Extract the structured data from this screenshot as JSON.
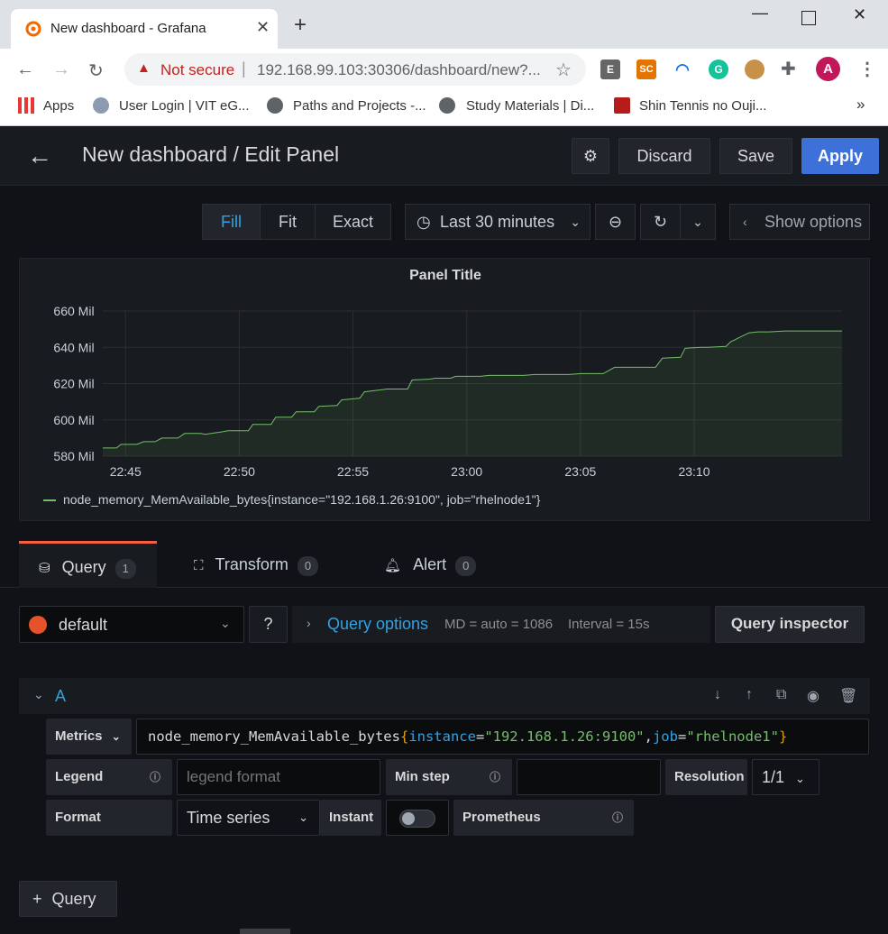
{
  "browser": {
    "tab_title": "New dashboard - Grafana",
    "new_tab": "+",
    "security_label": "Not secure",
    "url": "192.168.99.103:30306/dashboard/new?...",
    "bookmarks": [
      "Apps",
      "User Login | VIT eG...",
      "Paths and Projects -...",
      "Study Materials | Di...",
      "Shin Tennis no Ouji..."
    ],
    "bookmarks_more": "»",
    "profile_initial": "A",
    "ext_e": "E",
    "ext_sc": "SC",
    "ext_g": "G"
  },
  "header": {
    "title": "New dashboard / Edit Panel",
    "discard": "Discard",
    "save": "Save",
    "apply": "Apply"
  },
  "viz": {
    "fill": "Fill",
    "fit": "Fit",
    "exact": "Exact",
    "time_range": "Last 30 minutes",
    "show_options": "Show options"
  },
  "panel": {
    "title": "Panel Title",
    "legend": "node_memory_MemAvailable_bytes{instance=\"192.168.1.26:9100\", job=\"rhelnode1\"}"
  },
  "chart_data": {
    "type": "area",
    "title": "Panel Title",
    "y_ticks": [
      "660 Mil",
      "640 Mil",
      "620 Mil",
      "600 Mil",
      "580 Mil"
    ],
    "ylim": [
      580,
      660
    ],
    "x_ticks": [
      "22:45",
      "22:50",
      "22:55",
      "23:00",
      "23:05",
      "23:10"
    ],
    "series": [
      {
        "name": "node_memory_MemAvailable_bytes{instance=\"192.168.1.26:9100\", job=\"rhelnode1\"}",
        "color": "#73bf69",
        "x_minutes_from_2244": [
          0,
          0.6,
          0.8,
          1.5,
          1.8,
          2.3,
          2.6,
          3.3,
          3.6,
          4.3,
          4.5,
          5.3,
          5.5,
          6.4,
          6.6,
          7.4,
          7.6,
          8.3,
          8.5,
          9.3,
          9.5,
          10.3,
          10.5,
          11.3,
          11.5,
          12.2,
          12.5,
          13.4,
          13.6,
          14.4,
          14.6,
          15.3,
          15.5,
          16.6,
          17.0,
          17.5,
          18.5,
          19.0,
          20.5,
          21.0,
          22.0,
          22.5,
          23.0,
          24.3,
          24.6,
          25.4,
          25.6,
          26.3,
          26.6,
          27.4,
          27.6,
          28.4,
          28.8,
          29.3,
          30.0,
          31.3,
          32.5
        ],
        "values_mil": [
          584.5,
          584.5,
          586.5,
          586.5,
          588.0,
          588.0,
          590.0,
          590.0,
          592.5,
          592.5,
          592.0,
          593.5,
          594.0,
          594.0,
          597.5,
          597.5,
          601.5,
          601.5,
          604.5,
          604.5,
          607.5,
          608.0,
          611.0,
          612.0,
          615.5,
          616.5,
          617.0,
          617.0,
          622.0,
          622.5,
          623.0,
          623.0,
          624.0,
          624.0,
          624.5,
          624.5,
          624.5,
          625.0,
          625.0,
          625.5,
          625.5,
          629.0,
          629.0,
          629.0,
          634.0,
          634.5,
          639.5,
          640.0,
          640.0,
          640.5,
          643.0,
          648.0,
          648.5,
          648.5,
          649.0,
          649.0,
          649.0
        ]
      }
    ]
  },
  "tabs": {
    "query": "Query",
    "query_count": "1",
    "transform": "Transform",
    "transform_count": "0",
    "alert": "Alert",
    "alert_count": "0"
  },
  "query": {
    "datasource": "default",
    "options_label": "Query options",
    "md": "MD = auto = 1086",
    "interval": "Interval = 15s",
    "inspector": "Query inspector",
    "ref_id": "A",
    "metrics_label": "Metrics",
    "metric_name": "node_memory_MemAvailable_bytes",
    "metric_open": "{",
    "metric_k1": "instance",
    "metric_eq1": "=",
    "metric_v1": "\"192.168.1.26:9100\"",
    "metric_comma": ",",
    "metric_k2": "job",
    "metric_eq2": "=",
    "metric_v2": "\"rhelnode1\"",
    "metric_close": "}",
    "legend_label": "Legend",
    "legend_placeholder": "legend format",
    "min_step_label": "Min step",
    "resolution_label": "Resolution",
    "resolution_value": "1/1",
    "format_label": "Format",
    "format_value": "Time series",
    "instant_label": "Instant",
    "prometheus_label": "Prometheus",
    "add_query": "Query"
  }
}
